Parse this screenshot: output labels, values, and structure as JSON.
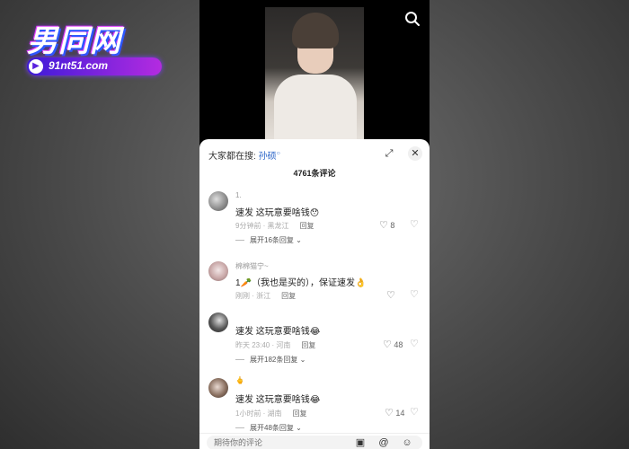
{
  "watermark": {
    "title": "男同网",
    "url": "91nt51.com"
  },
  "sheet": {
    "search_prefix": "大家都在搜:",
    "search_keyword": "孙硕",
    "comment_count": "4761条评论",
    "input_placeholder": "期待你的评论"
  },
  "comments": [
    {
      "username": "1.",
      "text": "速发 这玩意要啥钱😯",
      "time": "9分钟前 · 黑龙江",
      "reply": "回复",
      "likes": "8",
      "more": "展开16条回复"
    },
    {
      "username": "棉棉猫宁~",
      "text": "1🥕（我也是买的），保证速发👌",
      "time": "刚刚 · 浙江",
      "reply": "回复",
      "likes": "",
      "more": ""
    },
    {
      "username": "",
      "text": "速发 这玩意要啥钱😂",
      "time": "昨天 23:40 · 河南",
      "reply": "回复",
      "likes": "48",
      "more": "展开182条回复"
    },
    {
      "username": "🖕",
      "text": "速发 这玩意要啥钱😂",
      "time": "1小时前 · 湖南",
      "reply": "回复",
      "likes": "14",
      "more": "展开48条回复"
    }
  ]
}
